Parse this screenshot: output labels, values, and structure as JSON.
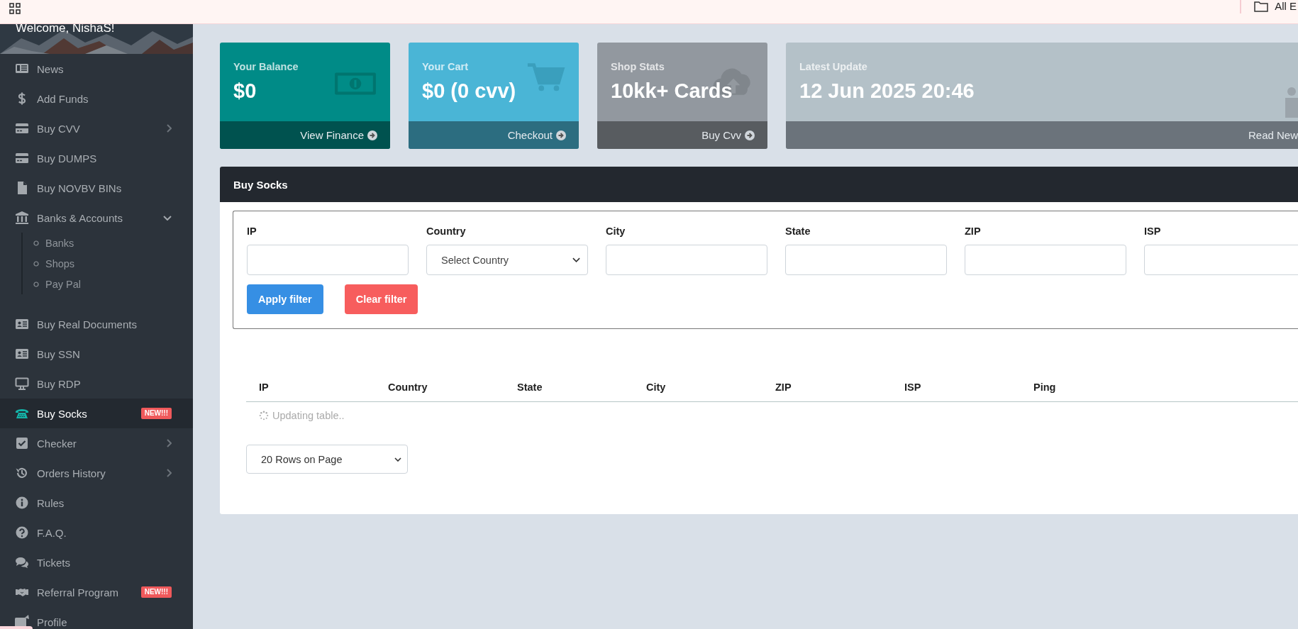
{
  "top_bar": {
    "folder_label": "All E"
  },
  "sidebar": {
    "welcome": "Welcome, NishaS!",
    "items": [
      {
        "label": "News",
        "selected": false
      },
      {
        "label": "Add Funds",
        "selected": false
      },
      {
        "label": "Buy CVV",
        "selected": false,
        "expanded": false
      },
      {
        "label": "Buy DUMPS",
        "selected": false
      },
      {
        "label": "Buy NOVBV BINs",
        "selected": false
      },
      {
        "label": "Banks & Accounts",
        "selected": false,
        "expanded": true,
        "children": [
          {
            "label": "Banks",
            "selected": false
          },
          {
            "label": "Shops",
            "selected": false
          },
          {
            "label": "Pay Pal",
            "selected": false
          }
        ]
      },
      {
        "label": "Buy Real Documents",
        "selected": false
      },
      {
        "label": "Buy SSN",
        "selected": false
      },
      {
        "label": "Buy RDP",
        "selected": false
      },
      {
        "label": "Buy Socks",
        "selected": true,
        "badge": "NEW!!!"
      },
      {
        "label": "Checker",
        "selected": false,
        "expanded": false
      },
      {
        "label": "Orders History",
        "selected": false,
        "expanded": false
      },
      {
        "label": "Rules",
        "selected": false
      },
      {
        "label": "F.A.Q.",
        "selected": false
      },
      {
        "label": "Tickets",
        "selected": false
      },
      {
        "label": "Referral Program",
        "selected": false,
        "badge": "NEW!!!"
      },
      {
        "label": "Profile",
        "selected": false
      }
    ]
  },
  "stat_cards": [
    {
      "kind": "balance",
      "title": "Your Balance",
      "value": "$0",
      "link": "View Finance"
    },
    {
      "kind": "cart",
      "title": "Your Cart",
      "value": "$0 (0 cvv)",
      "link": "Checkout"
    },
    {
      "kind": "stats",
      "title": "Shop Stats",
      "value": "10kk+ Cards",
      "link": "Buy Cvv"
    },
    {
      "kind": "update",
      "title": "Latest Update",
      "value": "12 Jun 2025 20:46",
      "link": "Read New"
    }
  ],
  "panel": {
    "title": "Buy Socks",
    "filters": [
      {
        "kind": "text",
        "label": "IP"
      },
      {
        "kind": "select",
        "label": "Country",
        "value": "Select Country"
      },
      {
        "kind": "text",
        "label": "City"
      },
      {
        "kind": "text",
        "label": "State"
      },
      {
        "kind": "text",
        "label": "ZIP"
      },
      {
        "kind": "text",
        "label": "ISP"
      }
    ],
    "buttons": [
      {
        "kind": "apply",
        "label": "Apply filter"
      },
      {
        "kind": "clear",
        "label": "Clear filter"
      }
    ],
    "table": {
      "columns": [
        "IP",
        "Country",
        "State",
        "City",
        "ZIP",
        "ISP",
        "Ping"
      ],
      "status": "Updating table.."
    },
    "rows_per_page": "20 Rows on Page"
  }
}
